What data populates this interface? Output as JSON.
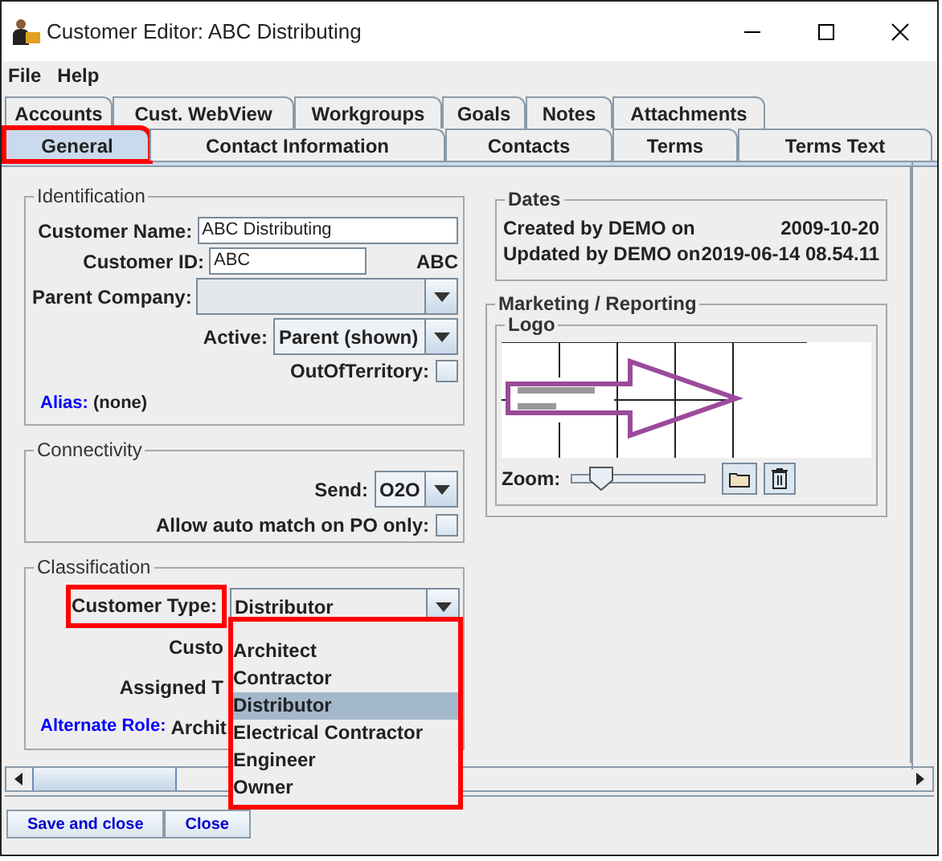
{
  "window": {
    "title": "Customer Editor: ABC Distributing"
  },
  "menu": [
    "File",
    "Help"
  ],
  "tab_rows": [
    [
      {
        "label": "Accounts",
        "selected": false
      },
      {
        "label": "Cust. WebView",
        "selected": false
      },
      {
        "label": "Workgroups",
        "selected": false
      },
      {
        "label": "Goals",
        "selected": false
      },
      {
        "label": "Notes",
        "selected": false
      },
      {
        "label": "Attachments",
        "selected": false
      }
    ],
    [
      {
        "label": "General",
        "selected": true,
        "highlighted": true
      },
      {
        "label": "Contact Information",
        "selected": false,
        "highlighted": false
      },
      {
        "label": "Contacts",
        "selected": false,
        "highlighted": false
      },
      {
        "label": "Terms",
        "selected": false,
        "highlighted": false
      },
      {
        "label": "Terms Text",
        "selected": false,
        "highlighted": false
      }
    ]
  ],
  "identification": {
    "title": "Identification",
    "customer_name_label": "Customer Name:",
    "customer_name": "ABC Distributing",
    "customer_id_label": "Customer ID:",
    "customer_id": "ABC",
    "customer_id_display": "ABC",
    "parent_company_label": "Parent Company:",
    "active_label": "Active:",
    "active": "Parent (shown)",
    "out_of_territory_label": "OutOfTerritory:",
    "out_of_territory": false,
    "alias_label": "Alias:",
    "alias": "(none)"
  },
  "connectivity": {
    "title": "Connectivity",
    "send_label": "Send:",
    "send": "O2O",
    "auto_match_label": "Allow auto match on PO only:",
    "auto_match": false
  },
  "classification": {
    "title": "Classification",
    "customer_type_label": "Customer Type:",
    "customer_type_highlighted": true,
    "customer_type": "Distributor",
    "row_2_label": "Custo",
    "row_3_label": "Assigned T",
    "alternate_role_label": "Alternate Role:",
    "alternate_role": "Archit"
  },
  "dropdown": {
    "highlighted": true,
    "options": [
      {
        "label": "Architect",
        "selected": false
      },
      {
        "label": "Contractor",
        "selected": false
      },
      {
        "label": "Distributor",
        "selected": true
      },
      {
        "label": "Electrical Contractor",
        "selected": false
      },
      {
        "label": "Engineer",
        "selected": false
      },
      {
        "label": "Owner",
        "selected": false
      }
    ]
  },
  "dates": {
    "title": "Dates",
    "created_label": "Created by DEMO on",
    "created": "2009-10-20",
    "updated_label": "Updated by DEMO on",
    "updated": "2019-06-14 08.54.11"
  },
  "marketing": {
    "title": "Marketing / Reporting",
    "logo_title": "Logo",
    "zoom_label": "Zoom:",
    "zoom": {
      "level": 0.22
    }
  },
  "buttons": [
    "Save and close",
    "Close"
  ]
}
